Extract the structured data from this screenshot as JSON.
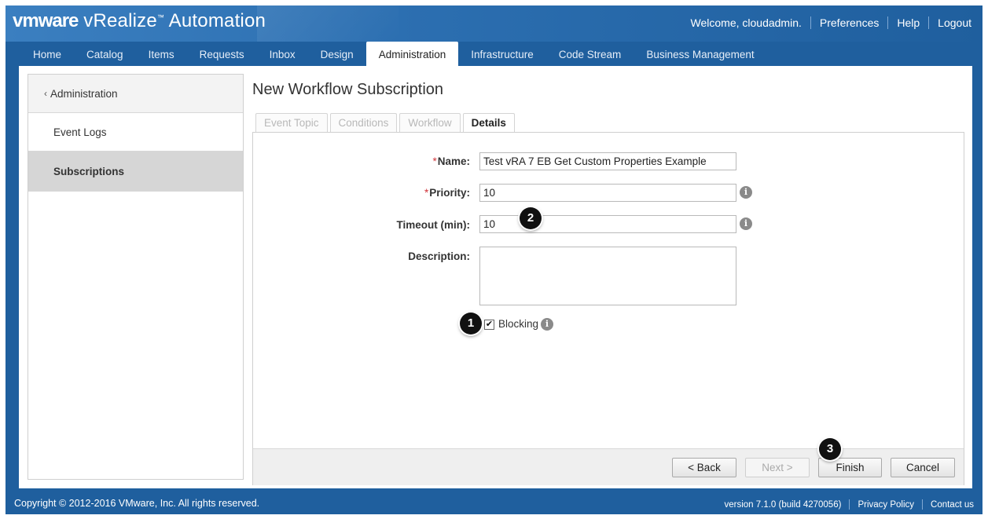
{
  "header": {
    "brand_vm": "vmware",
    "brand_product": "vRealize",
    "brand_suffix": "Automation",
    "welcome": "Welcome, cloudadmin.",
    "links": [
      "Preferences",
      "Help",
      "Logout"
    ]
  },
  "nav": {
    "tabs": [
      "Home",
      "Catalog",
      "Items",
      "Requests",
      "Inbox",
      "Design",
      "Administration",
      "Infrastructure",
      "Code Stream",
      "Business Management"
    ],
    "active": "Administration"
  },
  "sidebar": {
    "back_label": "Administration",
    "items": [
      {
        "label": "Event Logs",
        "active": false
      },
      {
        "label": "Subscriptions",
        "active": true
      }
    ]
  },
  "page": {
    "title": "New Workflow Subscription"
  },
  "wizard": {
    "tabs": [
      "Event Topic",
      "Conditions",
      "Workflow",
      "Details"
    ],
    "active": "Details"
  },
  "form": {
    "name_label": "Name:",
    "name_value": "Test vRA 7 EB Get Custom Properties Example",
    "priority_label": "Priority:",
    "priority_value": "10",
    "timeout_label": "Timeout (min):",
    "timeout_value": "10",
    "description_label": "Description:",
    "description_value": "",
    "blocking_label": "Blocking",
    "blocking_checked": true,
    "required_mark": "*",
    "info_glyph": "i"
  },
  "buttons": {
    "back": "< Back",
    "next": "Next >",
    "finish": "Finish",
    "cancel": "Cancel"
  },
  "markers": [
    "1",
    "2",
    "3"
  ],
  "footer": {
    "copyright": "Copyright © 2012-2016 VMware, Inc. All rights reserved.",
    "version": "version 7.1.0 (build 4270056)",
    "privacy": "Privacy Policy",
    "contact": "Contact us"
  },
  "colors": {
    "header_blue": "#1f5f9e",
    "required_red": "#d0343a"
  }
}
